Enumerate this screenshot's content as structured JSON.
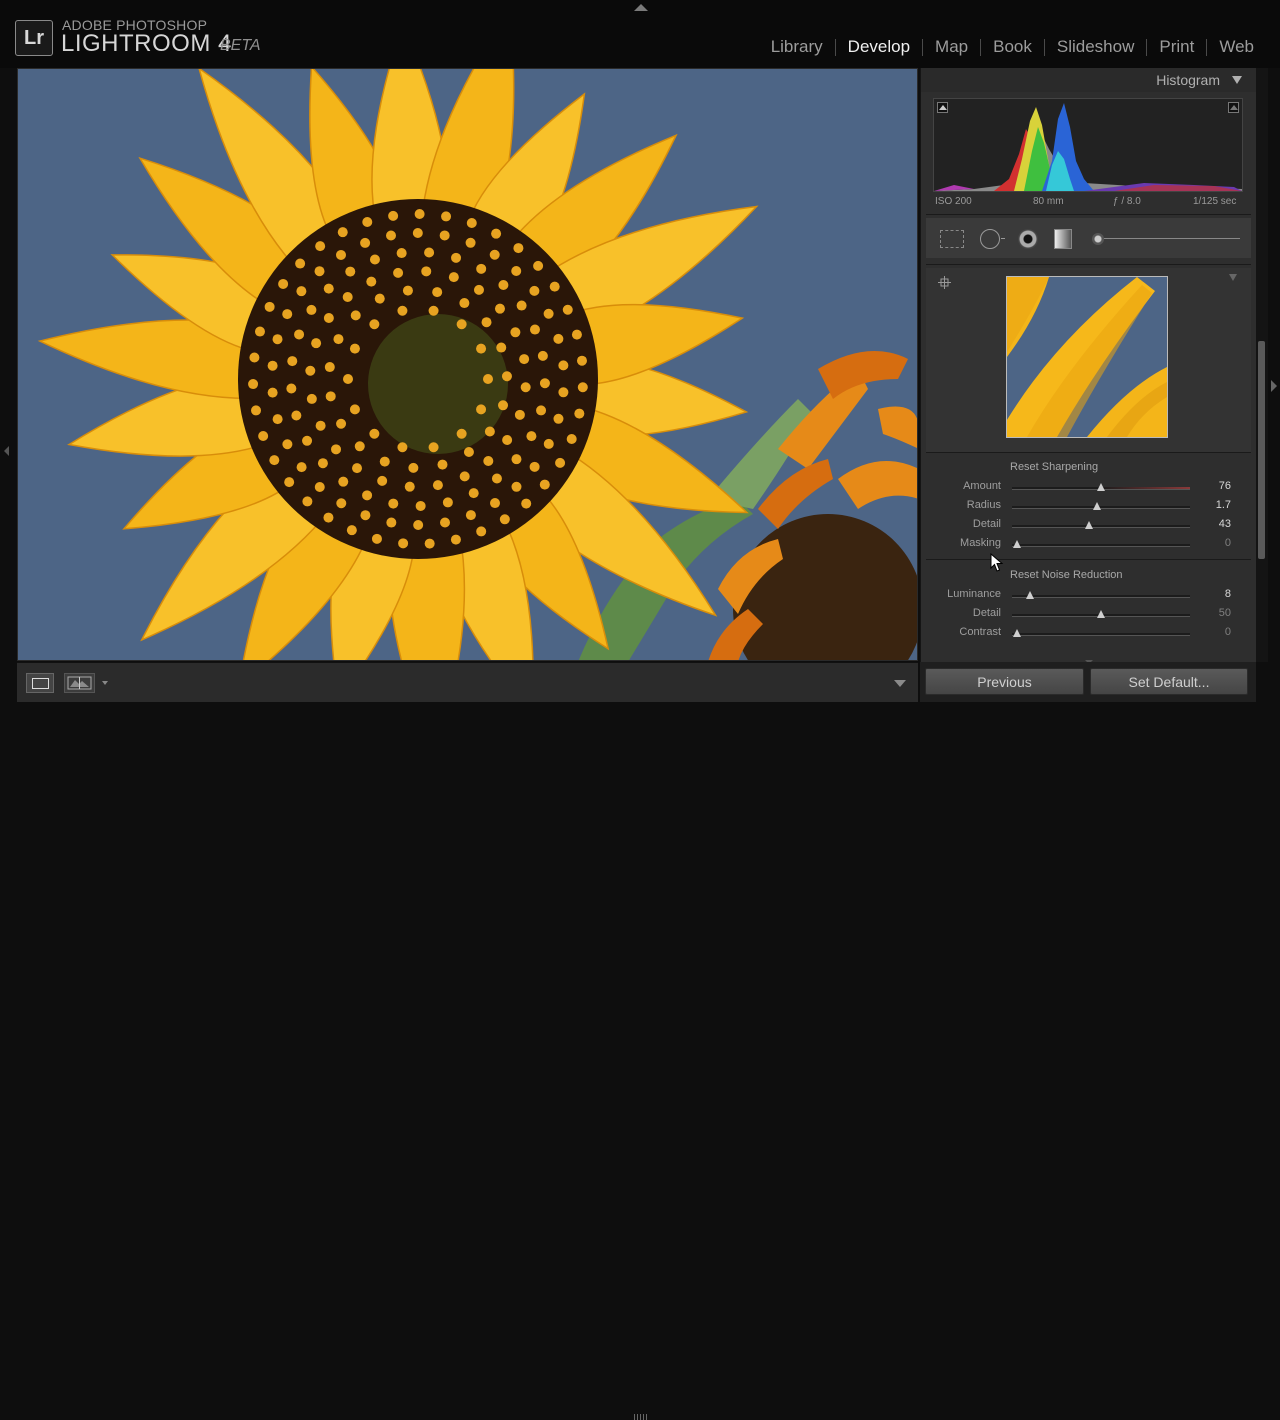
{
  "app": {
    "vendor": "ADOBE PHOTOSHOP",
    "name": "LIGHTROOM 4",
    "edition": "BETA",
    "logo": "Lr"
  },
  "modules": [
    {
      "label": "Library",
      "active": false
    },
    {
      "label": "Develop",
      "active": true
    },
    {
      "label": "Map",
      "active": false
    },
    {
      "label": "Book",
      "active": false
    },
    {
      "label": "Slideshow",
      "active": false
    },
    {
      "label": "Print",
      "active": false
    },
    {
      "label": "Web",
      "active": false
    }
  ],
  "histogram": {
    "title": "Histogram",
    "iso": "ISO 200",
    "focal": "80 mm",
    "aperture": "ƒ / 8.0",
    "shutter": "1/125 sec"
  },
  "sharpening": {
    "reset_label": "Reset Sharpening",
    "sliders": [
      {
        "label": "Amount",
        "value": "76",
        "fraction": 0.5,
        "fill": "#8a3a3a"
      },
      {
        "label": "Radius",
        "value": "1.7",
        "fraction": 0.48,
        "fill": ""
      },
      {
        "label": "Detail",
        "value": "43",
        "fraction": 0.43,
        "fill": ""
      },
      {
        "label": "Masking",
        "value": "0",
        "fraction": 0.03,
        "fill": ""
      }
    ]
  },
  "noise": {
    "reset_label": "Reset Noise Reduction",
    "sliders": [
      {
        "label": "Luminance",
        "value": "8",
        "fraction": 0.1,
        "fill": ""
      },
      {
        "label": "Detail",
        "value": "50",
        "fraction": 0.5,
        "fill": ""
      },
      {
        "label": "Contrast",
        "value": "0",
        "fraction": 0.03,
        "fill": ""
      }
    ]
  },
  "buttons": {
    "previous": "Previous",
    "set_default": "Set Default..."
  },
  "colors": {
    "sky": "#4d6586",
    "petal": "#f4b519",
    "petal_dark": "#d88d0a",
    "disk": "#2a1608",
    "floret": "#e7a321"
  }
}
